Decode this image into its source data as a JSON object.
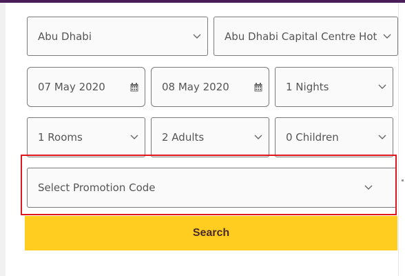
{
  "booking_form": {
    "city": {
      "value": "Abu Dhabi"
    },
    "hotel": {
      "value": "Abu Dhabi Capital Centre Hotel"
    },
    "checkin": {
      "value": "07 May 2020"
    },
    "checkout": {
      "value": "08 May 2020"
    },
    "nights": {
      "value": "1 Nights"
    },
    "rooms": {
      "value": "1 Rooms"
    },
    "adults": {
      "value": "2 Adults"
    },
    "children": {
      "value": "0 Children"
    },
    "promotion": {
      "placeholder": "Select Promotion Code"
    },
    "search_label": "Search"
  },
  "colors": {
    "header_bar": "#4b1e5a",
    "search_button": "#ffcd1f",
    "highlight_border": "#e0151b",
    "field_border": "#7a7a7a"
  },
  "icons": {
    "dropdown": "chevron-down-icon",
    "date": "calendar-icon"
  }
}
